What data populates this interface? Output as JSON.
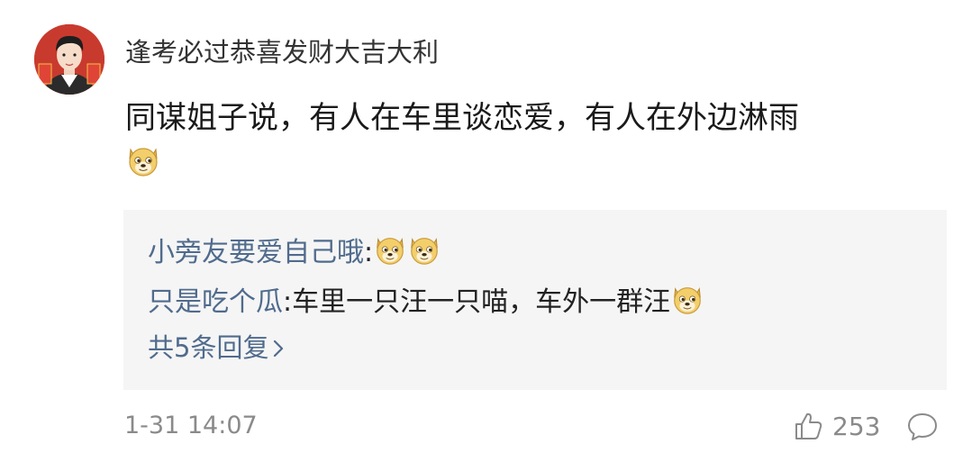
{
  "comment": {
    "username": "逢考必过恭喜发财大吉大利",
    "text": "同谋姐子说，有人在车里谈恋爱，有人在外边淋雨",
    "text_emoji": "doge-emoji",
    "avatar": "avatar-icon"
  },
  "replies": [
    {
      "user": "小旁友要爱自己哦",
      "sep": ":",
      "text": "",
      "emojis": [
        "doge-emoji",
        "doge-emoji"
      ]
    },
    {
      "user": "只是吃个瓜",
      "sep": ":",
      "text": "车里一只汪一只喵，车外一群汪",
      "emojis": [
        "doge-emoji"
      ]
    }
  ],
  "more_replies": "共5条回复",
  "footer": {
    "timestamp": "1-31 14:07",
    "like_count": "253",
    "like_icon": "thumbs-up-icon",
    "comment_icon": "comment-bubble-icon"
  },
  "colors": {
    "link": "#506b8d",
    "reply_bg": "#f5f5f5",
    "meta": "#8a8a8a"
  }
}
